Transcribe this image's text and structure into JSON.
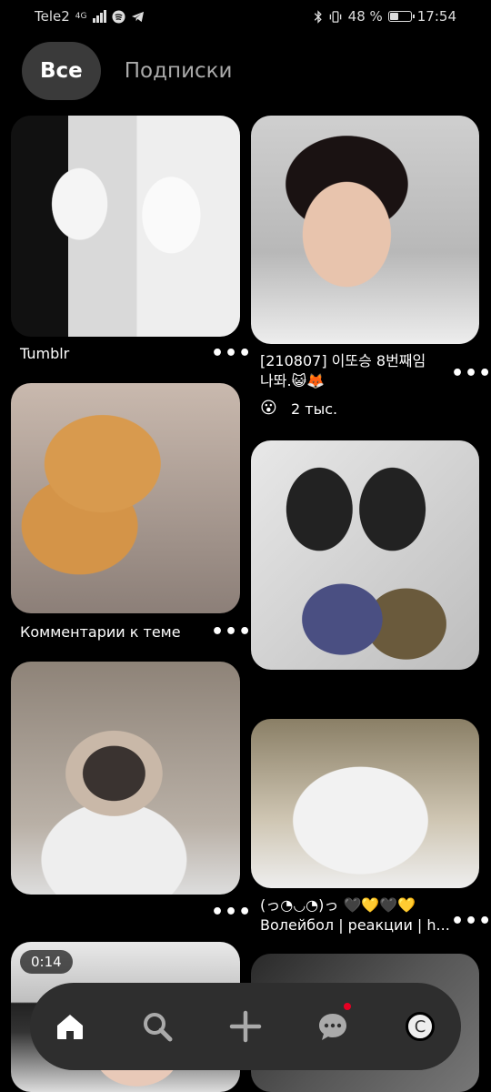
{
  "status_bar": {
    "carrier": "Tele2",
    "network": "4G",
    "battery_percent": "48 %",
    "battery_level": 0.48,
    "time": "17:54"
  },
  "tabs": [
    {
      "label": "Все",
      "active": true
    },
    {
      "label": "Подписки",
      "active": false
    }
  ],
  "pins": {
    "p1": {
      "caption": "Tumblr"
    },
    "p2": {
      "caption": "[210807] 이또승 8번째임 나똬.😺🦊",
      "reaction_icon": "😮",
      "reaction_count": "2 тыс."
    },
    "p3": {
      "caption": "Комментарии к теме"
    },
    "p5": {
      "caption_line1": "(っ◔◡◔)っ 🖤💛🖤💛",
      "caption_line2": "Волейбол | реакции | h..."
    },
    "p7": {
      "duration": "0:14"
    }
  },
  "more_label": "•••",
  "nav": {
    "avatar_letter": "C",
    "colors": {
      "notification": "#e60023"
    }
  }
}
